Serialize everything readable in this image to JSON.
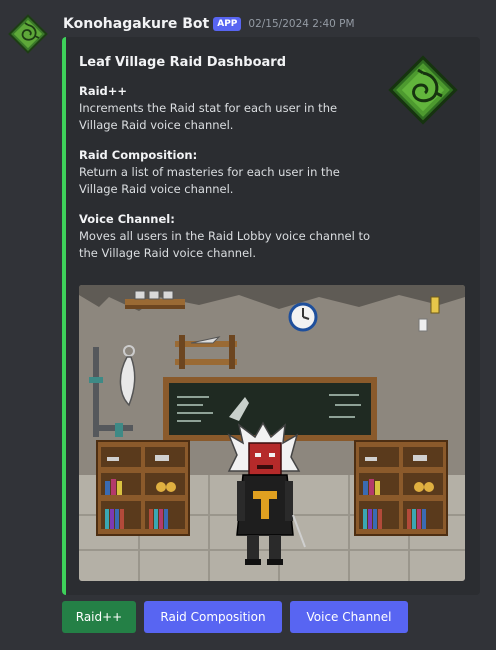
{
  "message": {
    "author": "Konohagakure Bot",
    "badge": "APP",
    "timestamp": "02/15/2024 2:40 PM"
  },
  "embed": {
    "accent_color": "#3ed15a",
    "title": "Leaf Village Raid Dashboard",
    "thumbnail_icon": "leaf-village-emblem-icon",
    "fields": [
      {
        "name": "Raid++",
        "value": "Increments the Raid stat for each user in the Village Raid voice channel."
      },
      {
        "name": "Raid Composition:",
        "value": "Return a list of masteries for each user in the Village Raid voice channel."
      },
      {
        "name": "Voice Channel:",
        "value": "Moves all users in the Raid Lobby voice channel to the Village Raid voice channel."
      }
    ],
    "image_description_icon": "pixel-art-dojo-room-image"
  },
  "buttons": [
    {
      "label": "Raid++",
      "color": "#248046"
    },
    {
      "label": "Raid Composition",
      "color": "#5865f2"
    },
    {
      "label": "Voice Channel",
      "color": "#5865f2"
    }
  ]
}
